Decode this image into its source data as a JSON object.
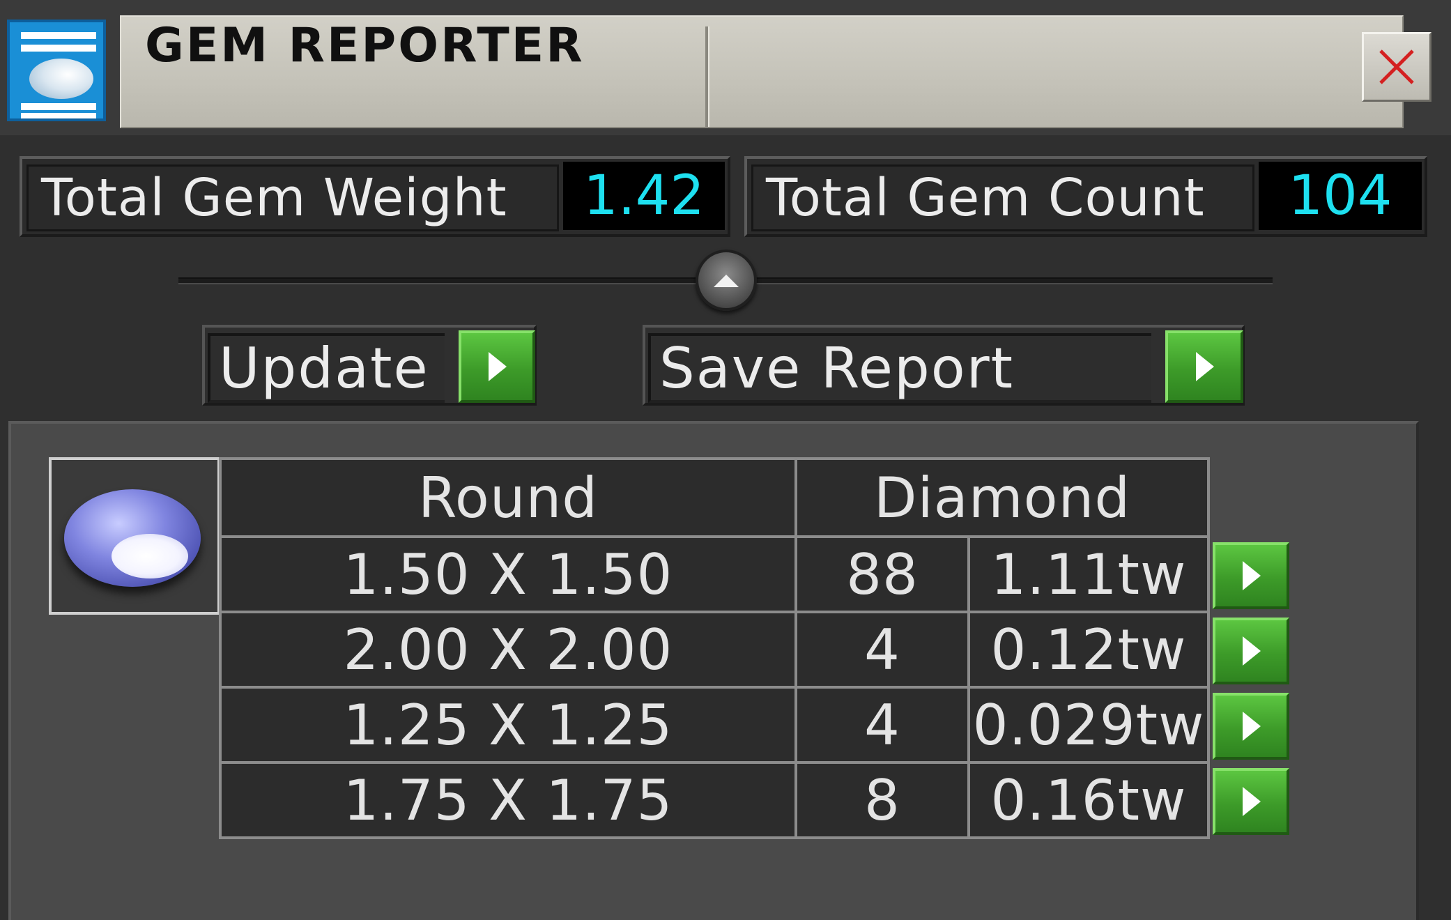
{
  "window": {
    "title": "GEM REPORTER",
    "app_icon": "gem-report-icon",
    "close_icon": "close-x-icon"
  },
  "stats": {
    "weight_label": "Total Gem Weight",
    "weight_value": "1.42",
    "count_label": "Total Gem Count",
    "count_value": "104"
  },
  "slider": {
    "knob_icon": "chevron-up-icon"
  },
  "actions": {
    "update_label": "Update",
    "save_label": "Save Report",
    "arrow_icon": "play-arrow-icon"
  },
  "gem_table": {
    "thumbnail_icon": "round-gem-icon",
    "shape": "Round",
    "material": "Diamond",
    "rows": [
      {
        "size": "1.50 X 1.50",
        "count": "88",
        "weight": "1.11tw"
      },
      {
        "size": "2.00 X 2.00",
        "count": "4",
        "weight": "0.12tw"
      },
      {
        "size": "1.25 X 1.25",
        "count": "4",
        "weight": "0.029tw"
      },
      {
        "size": "1.75 X 1.75",
        "count": "8",
        "weight": "0.16tw"
      }
    ]
  },
  "colors": {
    "value_text": "#1ee0f0",
    "button_green": "#3d9b29",
    "close_x": "#d42020",
    "title_bar": "#c4c2b8",
    "gem_blue": "#6a70d8"
  }
}
